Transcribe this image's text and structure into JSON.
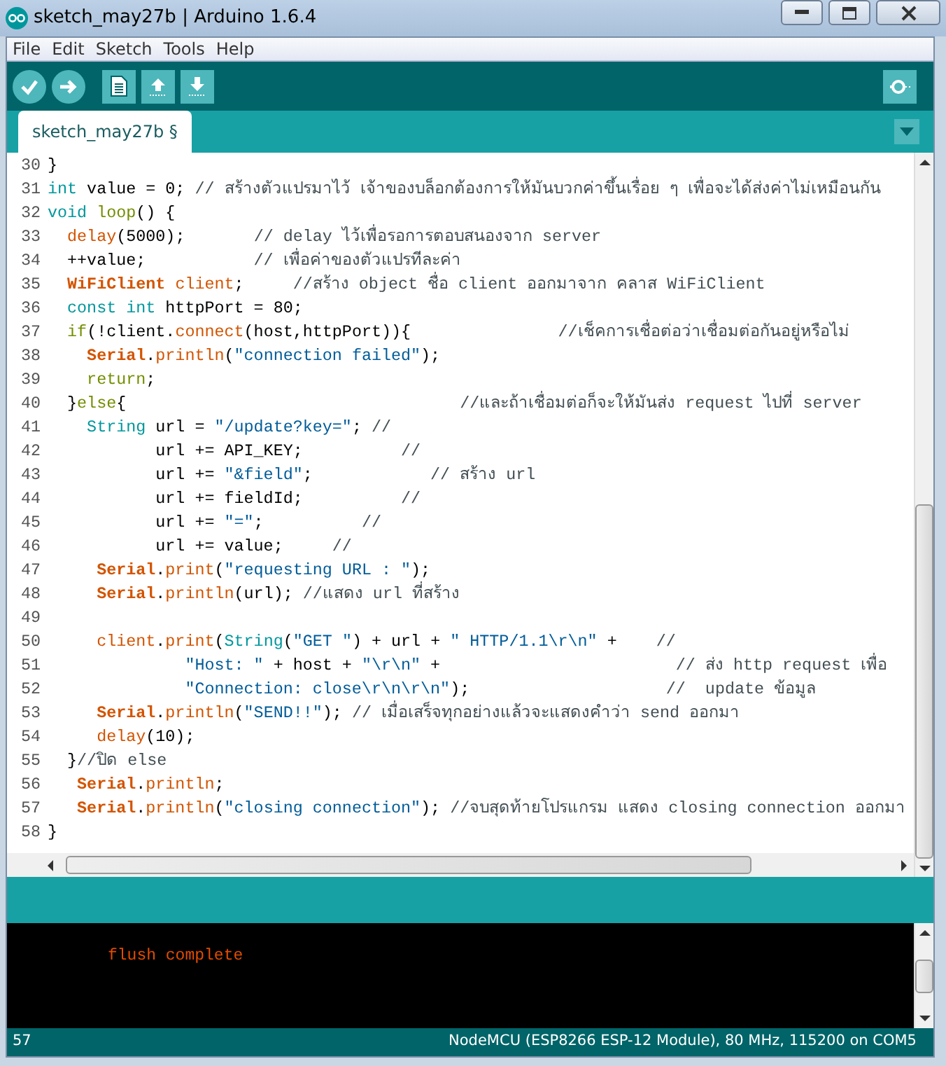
{
  "window": {
    "title": "sketch_may27b | Arduino 1.6.4"
  },
  "menu": [
    "File",
    "Edit",
    "Sketch",
    "Tools",
    "Help"
  ],
  "tabs": [
    {
      "label": "sketch_may27b §",
      "selected": true
    }
  ],
  "editor": {
    "lines": [
      {
        "number": "30",
        "tokens": [
          {
            "kind": "plain",
            "text": "}"
          }
        ]
      },
      {
        "number": "31",
        "tokens": [
          {
            "kind": "keyword",
            "text": "int"
          },
          {
            "kind": "plain",
            "text": " value = 0; "
          },
          {
            "kind": "comment",
            "text": "// สร้างตัวแปรมาไว้ เจ้าของบล็อกต้องการให้มันบวกค่าขึ้นเรื่อย ๆ เพื่อจะได้ส่งค่าไม่เหมือนกัน"
          }
        ]
      },
      {
        "number": "32",
        "tokens": [
          {
            "kind": "keyword",
            "text": "void "
          },
          {
            "kind": "control",
            "text": "loop"
          },
          {
            "kind": "plain",
            "text": "() {"
          }
        ]
      },
      {
        "number": "33",
        "tokens": [
          {
            "kind": "function",
            "text": "  delay"
          },
          {
            "kind": "plain",
            "text": "(5000);       "
          },
          {
            "kind": "comment",
            "text": "// delay ไว้เพื่อรอการตอบสนองจาก server"
          }
        ]
      },
      {
        "number": "34",
        "tokens": [
          {
            "kind": "plain",
            "text": "  ++value;           "
          },
          {
            "kind": "comment",
            "text": "// เพื่อค่าของตัวแปรทีละค่า"
          }
        ]
      },
      {
        "number": "35",
        "tokens": [
          {
            "kind": "class",
            "text": "  WiFiClient "
          },
          {
            "kind": "function",
            "text": "client"
          },
          {
            "kind": "plain",
            "text": ";     "
          },
          {
            "kind": "comment",
            "text": "//สร้าง object ชื่อ client ออกมาจาก คลาส WiFiClient"
          }
        ]
      },
      {
        "number": "36",
        "tokens": [
          {
            "kind": "keyword",
            "text": "  const int"
          },
          {
            "kind": "plain",
            "text": " httpPort = 80;"
          }
        ]
      },
      {
        "number": "37",
        "tokens": [
          {
            "kind": "control",
            "text": "  if"
          },
          {
            "kind": "plain",
            "text": "(!client."
          },
          {
            "kind": "function",
            "text": "connect"
          },
          {
            "kind": "plain",
            "text": "(host,httpPort)){               "
          },
          {
            "kind": "comment",
            "text": "//เช็คการเชื่อต่อว่าเชื่อมต่อกันอยู่หรือไม่"
          }
        ]
      },
      {
        "number": "38",
        "tokens": [
          {
            "kind": "class",
            "text": "    Serial"
          },
          {
            "kind": "plain",
            "text": "."
          },
          {
            "kind": "function",
            "text": "println"
          },
          {
            "kind": "plain",
            "text": "("
          },
          {
            "kind": "string",
            "text": "\"connection failed\""
          },
          {
            "kind": "plain",
            "text": ");"
          }
        ]
      },
      {
        "number": "39",
        "tokens": [
          {
            "kind": "control",
            "text": "    return"
          },
          {
            "kind": "plain",
            "text": ";"
          }
        ]
      },
      {
        "number": "40",
        "tokens": [
          {
            "kind": "plain",
            "text": "  }"
          },
          {
            "kind": "control",
            "text": "else"
          },
          {
            "kind": "plain",
            "text": "{                                  "
          },
          {
            "kind": "comment",
            "text": "//และถ้าเชื่อมต่อก็จะให้มันส่ง request ไปที่ server"
          }
        ]
      },
      {
        "number": "41",
        "tokens": [
          {
            "kind": "keyword",
            "text": "    String"
          },
          {
            "kind": "plain",
            "text": " url = "
          },
          {
            "kind": "string",
            "text": "\"/update?key=\""
          },
          {
            "kind": "plain",
            "text": "; "
          },
          {
            "kind": "comment",
            "text": "//"
          }
        ]
      },
      {
        "number": "42",
        "tokens": [
          {
            "kind": "plain",
            "text": "           url += API_KEY;          "
          },
          {
            "kind": "comment",
            "text": "//"
          }
        ]
      },
      {
        "number": "43",
        "tokens": [
          {
            "kind": "plain",
            "text": "           url += "
          },
          {
            "kind": "string",
            "text": "\"&field\""
          },
          {
            "kind": "plain",
            "text": ";            "
          },
          {
            "kind": "comment",
            "text": "// สร้าง url"
          }
        ]
      },
      {
        "number": "44",
        "tokens": [
          {
            "kind": "plain",
            "text": "           url += fieldId;          "
          },
          {
            "kind": "comment",
            "text": "//"
          }
        ]
      },
      {
        "number": "45",
        "tokens": [
          {
            "kind": "plain",
            "text": "           url += "
          },
          {
            "kind": "string",
            "text": "\"=\""
          },
          {
            "kind": "plain",
            "text": ";          "
          },
          {
            "kind": "comment",
            "text": "//"
          }
        ]
      },
      {
        "number": "46",
        "tokens": [
          {
            "kind": "plain",
            "text": "           url += value;     "
          },
          {
            "kind": "comment",
            "text": "//"
          }
        ]
      },
      {
        "number": "47",
        "tokens": [
          {
            "kind": "class",
            "text": "     Serial"
          },
          {
            "kind": "plain",
            "text": "."
          },
          {
            "kind": "function",
            "text": "print"
          },
          {
            "kind": "plain",
            "text": "("
          },
          {
            "kind": "string",
            "text": "\"requesting URL : \""
          },
          {
            "kind": "plain",
            "text": ");"
          }
        ]
      },
      {
        "number": "48",
        "tokens": [
          {
            "kind": "class",
            "text": "     Serial"
          },
          {
            "kind": "plain",
            "text": "."
          },
          {
            "kind": "function",
            "text": "println"
          },
          {
            "kind": "plain",
            "text": "(url); "
          },
          {
            "kind": "comment",
            "text": "//แสดง url ที่สร้าง"
          }
        ]
      },
      {
        "number": "49"
      },
      {
        "number": "50",
        "tokens": [
          {
            "kind": "function",
            "text": "     client"
          },
          {
            "kind": "plain",
            "text": "."
          },
          {
            "kind": "function",
            "text": "print"
          },
          {
            "kind": "plain",
            "text": "("
          },
          {
            "kind": "keyword",
            "text": "String"
          },
          {
            "kind": "plain",
            "text": "("
          },
          {
            "kind": "string",
            "text": "\"GET \""
          },
          {
            "kind": "plain",
            "text": ") + url + "
          },
          {
            "kind": "string",
            "text": "\" HTTP/1.1\\r\\n\""
          },
          {
            "kind": "plain",
            "text": " +    "
          },
          {
            "kind": "comment",
            "text": "//"
          }
        ]
      },
      {
        "number": "51",
        "tokens": [
          {
            "kind": "string",
            "text": "              \"Host: \""
          },
          {
            "kind": "plain",
            "text": " + host + "
          },
          {
            "kind": "string",
            "text": "\"\\r\\n\""
          },
          {
            "kind": "plain",
            "text": " +                        "
          },
          {
            "kind": "comment",
            "text": "// ส่ง http request เพื่อ"
          }
        ]
      },
      {
        "number": "52",
        "tokens": [
          {
            "kind": "string",
            "text": "              \"Connection: close\\r\\n\\r\\n\""
          },
          {
            "kind": "plain",
            "text": ");                    "
          },
          {
            "kind": "comment",
            "text": "//  update ข้อมูล"
          }
        ]
      },
      {
        "number": "53",
        "tokens": [
          {
            "kind": "class",
            "text": "     Serial"
          },
          {
            "kind": "plain",
            "text": "."
          },
          {
            "kind": "function",
            "text": "println"
          },
          {
            "kind": "plain",
            "text": "("
          },
          {
            "kind": "string",
            "text": "\"SEND!!\""
          },
          {
            "kind": "plain",
            "text": "); "
          },
          {
            "kind": "comment",
            "text": "// เมื่อเสร็จทุกอย่างแล้วจะแสดงคำว่า send ออกมา"
          }
        ]
      },
      {
        "number": "54",
        "tokens": [
          {
            "kind": "function",
            "text": "     delay"
          },
          {
            "kind": "plain",
            "text": "(10);"
          }
        ]
      },
      {
        "number": "55",
        "tokens": [
          {
            "kind": "plain",
            "text": "  }"
          },
          {
            "kind": "comment",
            "text": "//ปิด else"
          }
        ]
      },
      {
        "number": "56",
        "tokens": [
          {
            "kind": "class",
            "text": "   Serial"
          },
          {
            "kind": "plain",
            "text": "."
          },
          {
            "kind": "function",
            "text": "println"
          },
          {
            "kind": "plain",
            "text": ";"
          }
        ]
      },
      {
        "number": "57",
        "tokens": [
          {
            "kind": "class",
            "text": "   Serial"
          },
          {
            "kind": "plain",
            "text": "."
          },
          {
            "kind": "function",
            "text": "println"
          },
          {
            "kind": "plain",
            "text": "("
          },
          {
            "kind": "string",
            "text": "\"closing connection\""
          },
          {
            "kind": "plain",
            "text": "); "
          },
          {
            "kind": "comment",
            "text": "//จบสุดท้ายโปรแกรม แสดง closing connection ออกมา"
          }
        ]
      },
      {
        "number": "58",
        "tokens": [
          {
            "kind": "plain",
            "text": "}"
          }
        ]
      }
    ]
  },
  "console": {
    "lines": [
      "flush complete"
    ]
  },
  "status_bar": {
    "line": "57",
    "board": "NodeMCU (ESP8266 ESP-12 Module), 80 MHz, 115200 on COM5"
  }
}
